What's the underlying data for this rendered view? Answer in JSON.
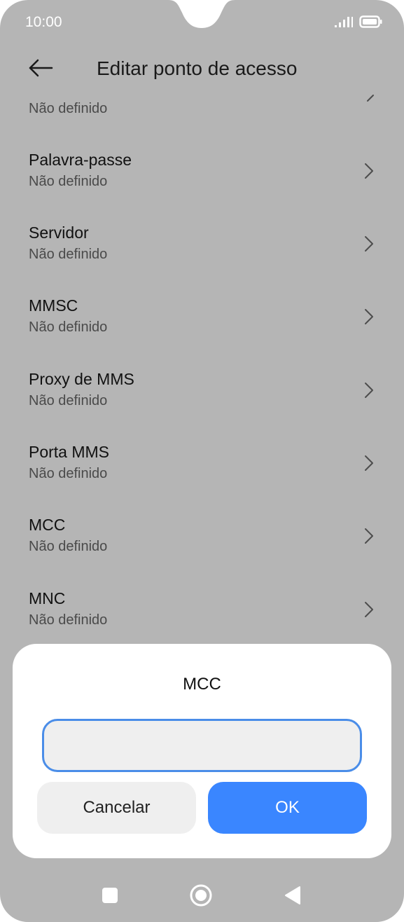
{
  "status_bar": {
    "time": "10:00",
    "icons": [
      "signal-icon",
      "battery-icon"
    ]
  },
  "header": {
    "title": "Editar ponto de acesso",
    "back_icon": "back-arrow-icon"
  },
  "list": {
    "partial_item": {
      "value": "Não definido"
    },
    "items": [
      {
        "label": "Palavra-passe",
        "value": "Não definido"
      },
      {
        "label": "Servidor",
        "value": "Não definido"
      },
      {
        "label": "MMSC",
        "value": "Não definido"
      },
      {
        "label": "Proxy de MMS",
        "value": "Não definido"
      },
      {
        "label": "Porta MMS",
        "value": "Não definido"
      },
      {
        "label": "MCC",
        "value": "Não definido"
      },
      {
        "label": "MNC",
        "value": "Não definido"
      }
    ]
  },
  "dialog": {
    "title": "MCC",
    "input_value": "",
    "input_placeholder": "",
    "cancel_label": "Cancelar",
    "ok_label": "OK"
  },
  "nav_bar": {
    "icons": [
      "recents-square-icon",
      "home-circle-icon",
      "back-triangle-icon"
    ]
  },
  "colors": {
    "overlay_background": "#b5b5b5",
    "dialog_background": "#ffffff",
    "accent": "#3a86ff",
    "input_border": "#4a8de8",
    "secondary_button": "#efefef"
  }
}
